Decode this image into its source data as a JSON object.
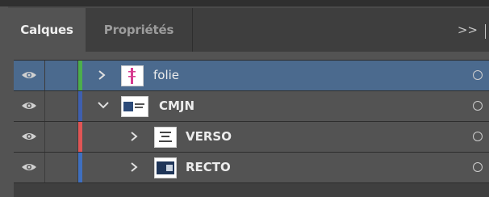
{
  "tabs": {
    "layers": "Calques",
    "properties": "Propriétés"
  },
  "menu": {
    "expand_label": ">>"
  },
  "layers": [
    {
      "name": "folie",
      "color": "#4cae4c",
      "selected": true,
      "expanded": false,
      "depth": 0,
      "chevron": "right"
    },
    {
      "name": "CMJN",
      "color": "#3f5fae",
      "selected": false,
      "expanded": true,
      "depth": 0,
      "chevron": "down"
    },
    {
      "name": "VERSO",
      "color": "#e05555",
      "selected": false,
      "expanded": false,
      "depth": 1,
      "chevron": "right"
    },
    {
      "name": "RECTO",
      "color": "#3f6fbf",
      "selected": false,
      "expanded": false,
      "depth": 1,
      "chevron": "right"
    }
  ],
  "icons": {
    "visibility": "eye-icon",
    "expand": "chevron-icon",
    "target": "target-circle-icon"
  }
}
